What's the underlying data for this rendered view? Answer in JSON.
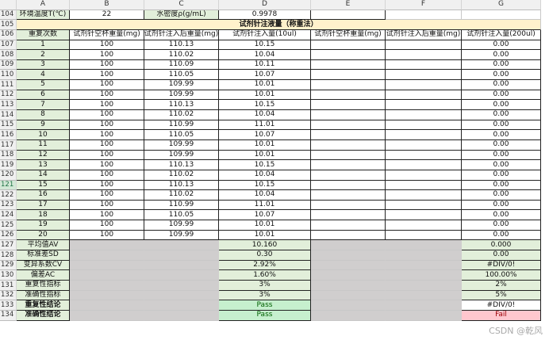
{
  "columns": [
    "A",
    "B",
    "C",
    "D",
    "E",
    "F",
    "G"
  ],
  "row104": {
    "num": "104",
    "a": "环境温度T(℃)",
    "b": "22",
    "c": "水密度ρ(g/mL)",
    "d": "0.9978"
  },
  "row105": {
    "num": "105",
    "title": "试剂针注液量（称重法）"
  },
  "row106": {
    "num": "106",
    "headers": [
      "重复次数",
      "试剂针空杯重量(mg)",
      "试剂针注入后重量(mg)",
      "试剂针注入量(10ul)",
      "试剂针空杯重量(mg)",
      "试剂针注入后重量(mg)",
      "试剂针注入量(200ul)"
    ]
  },
  "data_rows": [
    {
      "num": "107",
      "rep": "1",
      "b": "100",
      "c": "110.13",
      "d": "10.15",
      "g": "0.00"
    },
    {
      "num": "108",
      "rep": "2",
      "b": "100",
      "c": "110.02",
      "d": "10.04",
      "g": "0.00"
    },
    {
      "num": "109",
      "rep": "3",
      "b": "100",
      "c": "110.09",
      "d": "10.11",
      "g": "0.00"
    },
    {
      "num": "110",
      "rep": "4",
      "b": "100",
      "c": "110.05",
      "d": "10.07",
      "g": "0.00"
    },
    {
      "num": "111",
      "rep": "5",
      "b": "100",
      "c": "109.99",
      "d": "10.01",
      "g": "0.00"
    },
    {
      "num": "112",
      "rep": "6",
      "b": "100",
      "c": "109.99",
      "d": "10.01",
      "g": "0.00"
    },
    {
      "num": "113",
      "rep": "7",
      "b": "100",
      "c": "110.13",
      "d": "10.15",
      "g": "0.00"
    },
    {
      "num": "114",
      "rep": "8",
      "b": "100",
      "c": "110.02",
      "d": "10.04",
      "g": "0.00"
    },
    {
      "num": "115",
      "rep": "9",
      "b": "100",
      "c": "110.99",
      "d": "11.01",
      "g": "0.00"
    },
    {
      "num": "116",
      "rep": "10",
      "b": "100",
      "c": "110.05",
      "d": "10.07",
      "g": "0.00"
    },
    {
      "num": "117",
      "rep": "11",
      "b": "100",
      "c": "109.99",
      "d": "10.01",
      "g": "0.00"
    },
    {
      "num": "118",
      "rep": "12",
      "b": "100",
      "c": "109.99",
      "d": "10.01",
      "g": "0.00"
    },
    {
      "num": "119",
      "rep": "13",
      "b": "100",
      "c": "110.13",
      "d": "10.15",
      "g": "0.00"
    },
    {
      "num": "120",
      "rep": "14",
      "b": "100",
      "c": "110.02",
      "d": "10.04",
      "g": "0.00"
    },
    {
      "num": "121",
      "rep": "15",
      "b": "100",
      "c": "110.13",
      "d": "10.15",
      "g": "0.00",
      "selected": true
    },
    {
      "num": "122",
      "rep": "16",
      "b": "100",
      "c": "110.02",
      "d": "10.04",
      "g": "0.00"
    },
    {
      "num": "123",
      "rep": "17",
      "b": "100",
      "c": "110.99",
      "d": "11.01",
      "g": "0.00"
    },
    {
      "num": "124",
      "rep": "18",
      "b": "100",
      "c": "110.05",
      "d": "10.07",
      "g": "0.00"
    },
    {
      "num": "125",
      "rep": "19",
      "b": "100",
      "c": "109.99",
      "d": "10.01",
      "g": "0.00"
    },
    {
      "num": "126",
      "rep": "20",
      "b": "100",
      "c": "109.99",
      "d": "10.01",
      "g": "0.00"
    }
  ],
  "summary_rows": [
    {
      "num": "127",
      "label": "平均值AV",
      "d": "10.160",
      "g": "0.000",
      "bold": false
    },
    {
      "num": "128",
      "label": "标准差SD",
      "d": "0.30",
      "g": "0.00",
      "bold": false
    },
    {
      "num": "129",
      "label": "变异系数CV",
      "d": "2.92%",
      "g": "#DIV/0!",
      "bold": false
    },
    {
      "num": "130",
      "label": "偏差AC",
      "d": "1.60%",
      "g": "100.00%",
      "bold": false
    },
    {
      "num": "131",
      "label": "重复性指标",
      "d": "3%",
      "g": "2%",
      "bold": false
    },
    {
      "num": "132",
      "label": "准确性指标",
      "d": "3%",
      "g": "5%",
      "bold": false
    },
    {
      "num": "133",
      "label": "重复性结论",
      "d": "Pass",
      "g": "#DIV/0!",
      "bold": true,
      "d_style": "pass",
      "g_style": "plain"
    },
    {
      "num": "134",
      "label": "准确性结论",
      "d": "Pass",
      "g": "Fail",
      "bold": true,
      "d_style": "pass",
      "g_style": "fail"
    }
  ],
  "watermark": "CSDN @乾风",
  "colors": {
    "header_gray": "#f0f0f0",
    "label_green": "#e2efda",
    "title_yellow": "#fff2cc",
    "block_gray": "#d0cece",
    "pass_green": "#c6efce",
    "fail_red": "#ffc7ce"
  }
}
